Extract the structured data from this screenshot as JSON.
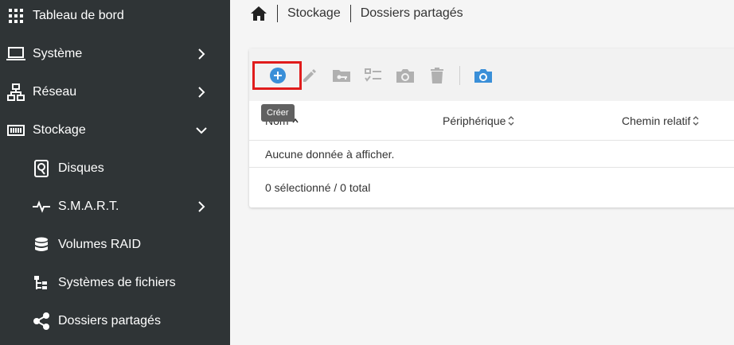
{
  "sidebar": {
    "items": [
      {
        "label": "Tableau de bord",
        "icon": "grid-icon"
      },
      {
        "label": "Système",
        "icon": "laptop-icon",
        "expandable": true
      },
      {
        "label": "Réseau",
        "icon": "network-icon",
        "expandable": true
      },
      {
        "label": "Stockage",
        "icon": "storage-icon",
        "expanded": true
      },
      {
        "label": "Disques",
        "icon": "disk-icon"
      },
      {
        "label": "S.M.A.R.T.",
        "icon": "pulse-icon",
        "expandable": true
      },
      {
        "label": "Volumes RAID",
        "icon": "database-icon"
      },
      {
        "label": "Systèmes de fichiers",
        "icon": "file-tree-icon"
      },
      {
        "label": "Dossiers partagés",
        "icon": "share-icon"
      }
    ]
  },
  "breadcrumb": {
    "items": [
      "Stockage",
      "Dossiers partagés"
    ]
  },
  "toolbar": {
    "tooltip": "Créer",
    "buttons": [
      "create",
      "edit",
      "privileges",
      "acl",
      "snapshot",
      "delete",
      "snapshots"
    ]
  },
  "table": {
    "columns": [
      "Nom",
      "Périphérique",
      "Chemin relatif"
    ],
    "empty_text": "Aucune donnée à afficher.",
    "footer": "0 sélectionné / 0 total"
  },
  "colors": {
    "sidebar_bg": "#2f3436",
    "accent": "#3a8fd8",
    "highlight": "#e01c1c",
    "disabled_icon": "#b0b0b0"
  }
}
